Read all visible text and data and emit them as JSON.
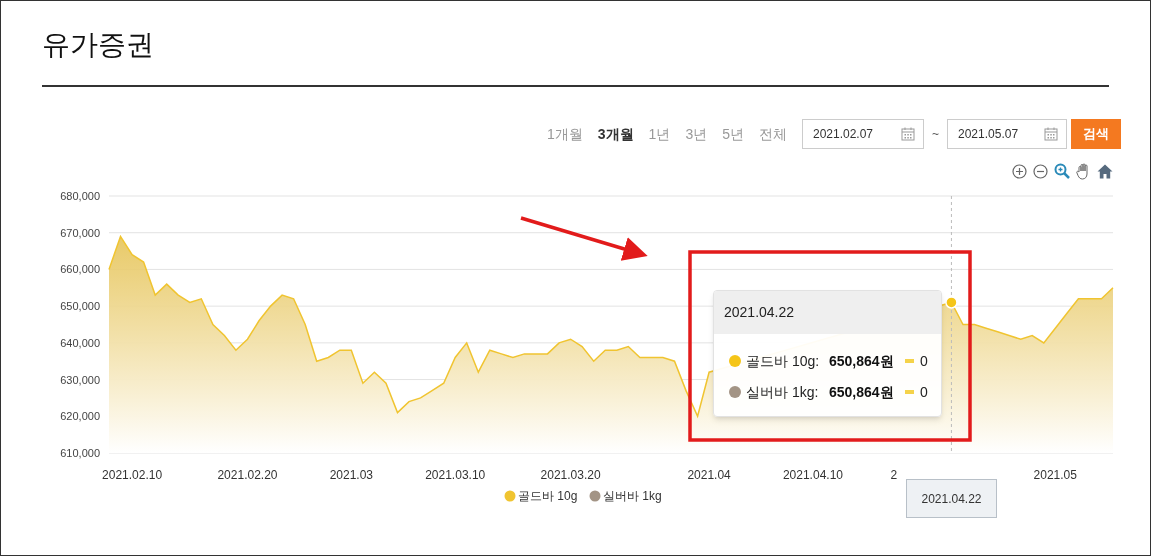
{
  "title": "유가증권",
  "periods": [
    {
      "label": "1개월",
      "selected": false
    },
    {
      "label": "3개월",
      "selected": true
    },
    {
      "label": "1년",
      "selected": false
    },
    {
      "label": "3년",
      "selected": false
    },
    {
      "label": "5년",
      "selected": false
    },
    {
      "label": "전체",
      "selected": false
    }
  ],
  "date_range": {
    "start": "2021.02.07",
    "separator": "~",
    "end": "2021.05.07"
  },
  "search_button": "검색",
  "chart": {
    "chart_data": {
      "type": "area",
      "categories": [
        null,
        null,
        "2021.02.10",
        null,
        null,
        null,
        null,
        null,
        null,
        null,
        null,
        null,
        "2021.02.20",
        null,
        null,
        null,
        null,
        null,
        null,
        null,
        null,
        "2021.03",
        null,
        null,
        null,
        null,
        null,
        null,
        null,
        null,
        "2021.03.10",
        null,
        null,
        null,
        null,
        null,
        null,
        null,
        null,
        null,
        "2021.03.20",
        null,
        null,
        null,
        null,
        null,
        null,
        null,
        null,
        null,
        null,
        null,
        "2021.04",
        null,
        null,
        null,
        null,
        null,
        null,
        null,
        null,
        "2021.04.10",
        null,
        null,
        null,
        null,
        null,
        null,
        "2",
        null,
        null,
        null,
        null,
        null,
        null,
        null,
        null,
        null,
        null,
        null,
        null,
        null,
        "2021.05",
        null,
        null,
        null,
        null,
        null
      ],
      "series": [
        {
          "name": "골드바 10g",
          "color": "#f0c430",
          "values": [
            660000,
            669000,
            664000,
            662000,
            653000,
            656000,
            653000,
            651000,
            652000,
            645000,
            642000,
            638000,
            641000,
            646000,
            650000,
            653000,
            652000,
            645000,
            635000,
            636000,
            638000,
            638000,
            629000,
            632000,
            629000,
            621000,
            624000,
            625000,
            627000,
            629000,
            636000,
            640000,
            632000,
            638000,
            637000,
            636000,
            637000,
            637000,
            637000,
            640000,
            641000,
            639000,
            635000,
            638000,
            638000,
            639000,
            636000,
            636000,
            636000,
            635000,
            627000,
            620000,
            632000,
            null,
            null,
            null,
            null,
            null,
            null,
            null,
            null,
            null,
            null,
            null,
            null,
            null,
            null,
            null,
            null,
            null,
            null,
            null,
            null,
            651000,
            645000,
            645000,
            644000,
            643000,
            642000,
            641000,
            642000,
            640000,
            644000,
            648000,
            652000,
            652000,
            652000,
            655000
          ]
        }
      ],
      "ylim": [
        610000,
        680000
      ],
      "grid": true,
      "yticks": [
        {
          "value": 610000,
          "label": "610,000"
        },
        {
          "value": 620000,
          "label": "620,000"
        },
        {
          "value": 630000,
          "label": "630,000"
        },
        {
          "value": 640000,
          "label": "640,000"
        },
        {
          "value": 650000,
          "label": "650,000"
        },
        {
          "value": 660000,
          "label": "660,000"
        },
        {
          "value": 670000,
          "label": "670,000"
        },
        {
          "value": 680000,
          "label": "680,000"
        }
      ]
    },
    "legend": [
      {
        "label": "실버바 1kg",
        "color": "#a39485"
      }
    ],
    "tooltip": {
      "date": "2021.04.22",
      "rows": [
        {
          "label": "골드바 10g:",
          "value": "650,864원",
          "change": "0",
          "color": "#f5c518"
        },
        {
          "label": "실버바 1kg:",
          "value": "650,864원",
          "change": "0",
          "color": "#a39485"
        }
      ]
    },
    "crosshair_label": "2021.04.22"
  }
}
